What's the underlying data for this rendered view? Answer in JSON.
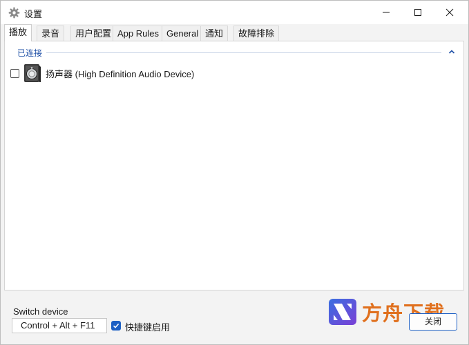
{
  "window": {
    "title": "设置"
  },
  "titlebar": {
    "icon": "gear-icon"
  },
  "tabs": [
    {
      "label": "播放",
      "active": true
    },
    {
      "label": "录音"
    },
    {
      "label": "用户配置"
    },
    {
      "label": "App Rules"
    },
    {
      "label": "General"
    },
    {
      "label": "通知"
    },
    {
      "label": "故障排除"
    }
  ],
  "devices": {
    "group_title": "已连接",
    "items": [
      {
        "name": "扬声器 (High Definition Audio Device)",
        "checked": false,
        "icon": "speaker-icon"
      }
    ]
  },
  "footer": {
    "switch_label": "Switch device",
    "hotkey_value": "Control + Alt + F11",
    "hotkey_enabled_label": "快捷键启用",
    "hotkey_enabled": true,
    "close_label": "关闭"
  },
  "watermark": {
    "text": "方舟下载"
  },
  "colors": {
    "accent": "#1d60c4",
    "group_title": "#1e4fa6",
    "watermark": "#e0701e"
  }
}
